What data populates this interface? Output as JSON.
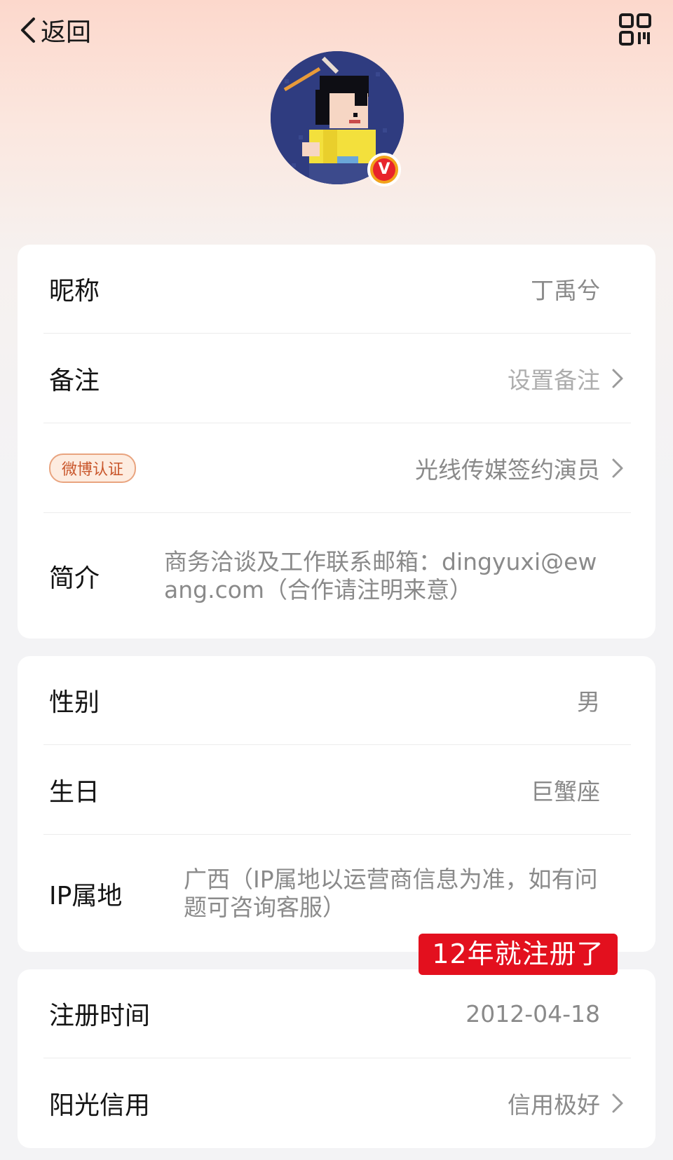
{
  "header": {
    "back_label": "返回",
    "back_icon": "chevron-left-icon",
    "qr_icon": "qr-code-icon"
  },
  "profile": {
    "verified_badge": "V"
  },
  "info_card": {
    "nickname_label": "昵称",
    "nickname_value": "丁禹兮",
    "remark_label": "备注",
    "remark_value": "设置备注",
    "cert_badge": "微博认证",
    "cert_value": "光线传媒签约演员",
    "bio_label": "简介",
    "bio_value": "商务洽谈及工作联系邮箱：dingyuxi@ewang.com（合作请注明来意）"
  },
  "detail_card": {
    "gender_label": "性别",
    "gender_value": "男",
    "birthday_label": "生日",
    "birthday_value": "巨蟹座",
    "ip_label": "IP属地",
    "ip_value": "广西（IP属地以运营商信息为准，如有问题可咨询客服）"
  },
  "annotation": {
    "text": "12年就注册了",
    "color": "#e3101e"
  },
  "account_card": {
    "register_label": "注册时间",
    "register_value": "2012-04-18",
    "credit_label": "阳光信用",
    "credit_value": "信用极好"
  }
}
